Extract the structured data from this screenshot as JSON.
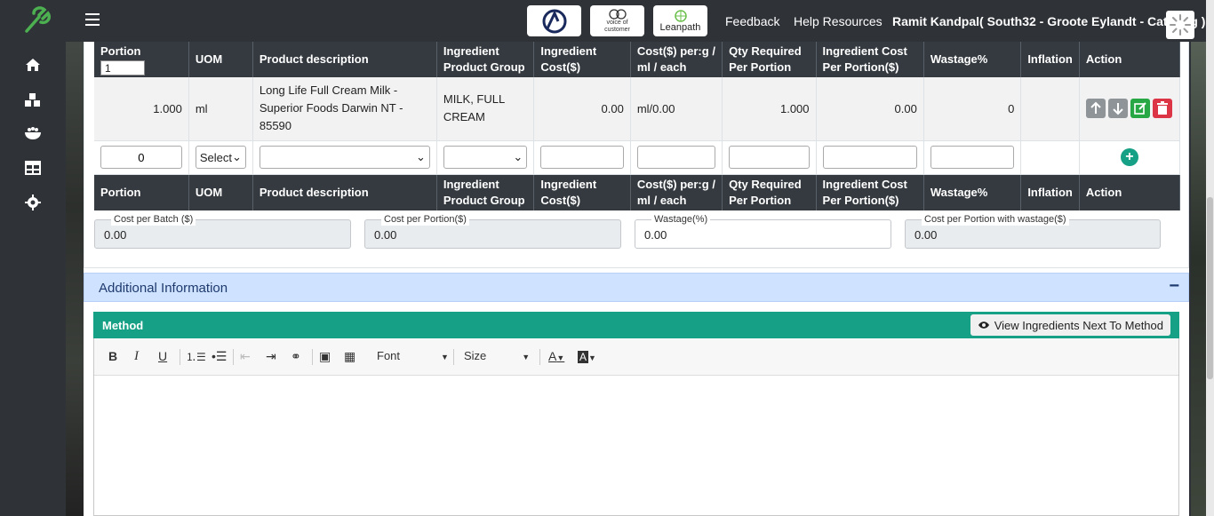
{
  "header": {
    "brands": [
      "AD",
      "voice of customer",
      "Leanpath"
    ],
    "links": [
      "Feedback",
      "Help Resources"
    ],
    "user": "Ramit Kandpal( South32 - Groote Eylandt - Catering )"
  },
  "sidebar": {
    "items": [
      "home-icon",
      "warehouse-icon",
      "food-bowl-icon",
      "table-icon",
      "gear-icon"
    ]
  },
  "table": {
    "headers": [
      "Portion",
      "UOM",
      "Product description",
      "Ingredient Product Group",
      "Ingredient Cost($)",
      "Cost($) per:g / ml / each",
      "Qty Required Per Portion",
      "Ingredient Cost Per Portion($)",
      "Wastage%",
      "Inflation",
      "Action"
    ],
    "portion_value": "1",
    "row": {
      "portion": "1.000",
      "uom": "ml",
      "product": "Long Life Full Cream Milk - Superior Foods Darwin NT - 85590",
      "group": "MILK, FULL CREAM",
      "cost": "0.00",
      "cost_per": "ml/0.00",
      "qty": "1.000",
      "cost_portion": "0.00",
      "wastage": "0",
      "inflation": ""
    },
    "entry": {
      "portion": "0",
      "uom": "Select"
    }
  },
  "costs": {
    "batch_label": "Cost per Batch ($)",
    "batch_value": "0.00",
    "portion_label": "Cost per Portion($)",
    "portion_value": "0.00",
    "wastage_label": "Wastage(%)",
    "wastage_value": "0.00",
    "with_wastage_label": "Cost per Portion with wastage($)",
    "with_wastage_value": "0.00"
  },
  "additional": {
    "title": "Additional Information",
    "toggle": "−"
  },
  "method": {
    "title": "Method",
    "view_button": "View Ingredients Next To Method",
    "font_label": "Font",
    "size_label": "Size"
  },
  "colors": {
    "header_bg": "#2f3338",
    "table_head": "#343a40",
    "method_bg": "#16a085",
    "addinfo_bg": "#cfe2ff"
  }
}
